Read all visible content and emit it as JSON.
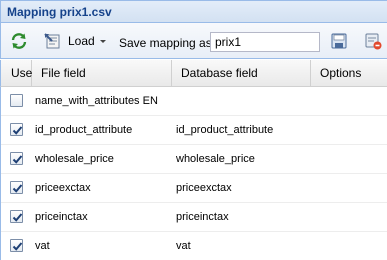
{
  "window": {
    "title": "Mapping prix1.csv"
  },
  "toolbar": {
    "refresh_icon": "refresh-icon",
    "load_label": "Load",
    "save_mapping_label": "Save mapping as",
    "mapping_name_value": "prix1",
    "save_icon": "save-icon",
    "delete_icon": "delete-icon"
  },
  "grid": {
    "columns": [
      "Use",
      "File field",
      "Database field",
      "Options"
    ],
    "rows": [
      {
        "use": false,
        "file_field": "name_with_attributes EN",
        "database_field": ""
      },
      {
        "use": true,
        "file_field": "id_product_attribute",
        "database_field": "id_product_attribute"
      },
      {
        "use": true,
        "file_field": "wholesale_price",
        "database_field": "wholesale_price"
      },
      {
        "use": true,
        "file_field": "priceexctax",
        "database_field": "priceexctax"
      },
      {
        "use": true,
        "file_field": "priceinctax",
        "database_field": "priceinctax"
      },
      {
        "use": true,
        "file_field": "vat",
        "database_field": "vat"
      }
    ]
  },
  "colors": {
    "title_text": "#15428b",
    "panel_border": "#99bbe8",
    "check_mark": "#1e3f74"
  }
}
